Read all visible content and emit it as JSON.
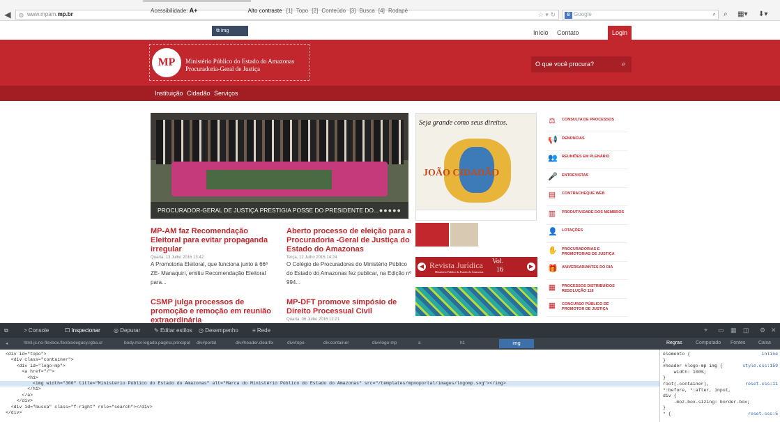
{
  "browser": {
    "url_prefix": "www.mpam.",
    "url_domain": "mp.br",
    "search_engine": "Google",
    "star_icon": "star-icon"
  },
  "topbar": {
    "accessibility_label": "Acessibilidade:",
    "font_increase": "A+",
    "contrast": "Alto contraste",
    "skip_links": "[1] Topo  [2] Conteúdo  [3] Busca  [4] Rodapé",
    "tooltip": "img",
    "inicio": "Início",
    "contato": "Contato",
    "login": "Login"
  },
  "header": {
    "logo_letters": "MP",
    "line1": "Ministério Público do Estado do Amazonas",
    "line2": "Procuradoria-Geral de Justiça",
    "search_placeholder": "O que você procura?"
  },
  "nav": {
    "items": [
      "Instituição",
      "Cidadão",
      "Serviços"
    ]
  },
  "hero": {
    "caption": "PROCURADOR-GERAL DE JUSTIÇA PRESTIGIA POSSE DO PRESIDENTE DO...",
    "dots": "●●●●●"
  },
  "news": [
    {
      "title": "MP-AM faz Recomendação Eleitoral para evitar propaganda irregular",
      "date": "Quarta, 13 Julho 2016 13:42",
      "text": "A Promotoria Eleitoral, que funciona junto à 66ª ZE- Manaquiri, emitiu Recomendação Eleitoral para..."
    },
    {
      "title": "Aberto processo de eleição para a Procuradoria -Geral de Justiça do Estado do Amazonas",
      "date": "Terça, 12 Julho 2016 14:24",
      "text": "O Colégio de Procuradores do Ministério Público do Estado do Amazonas fez publicar, na Edição nº 994..."
    },
    {
      "title": "CSMP julga processos de promoção e remoção em reunião extraordinária",
      "date": "",
      "text": ""
    },
    {
      "title": "MP-DFT promove simpósio de Direito Processual Civil",
      "date": "Quarta, 06 Julho 2016 12:21",
      "text": ""
    }
  ],
  "campaign": {
    "slogan": "Seja grande como seus direitos.",
    "word": "JOÃO CIDADÃO"
  },
  "revista": {
    "title": "Revista Jurídica",
    "vol": "Vol.",
    "vol_num": "16",
    "subtitle": "Ministério Público do Estado do Amazonas"
  },
  "side_items": [
    {
      "icon": "gavel-icon",
      "glyph": "⚖",
      "label": "Consulta de Processos"
    },
    {
      "icon": "megaphone-icon",
      "glyph": "📢",
      "label": "Denúncias"
    },
    {
      "icon": "people-icon",
      "glyph": "👥",
      "label": "Reuniões em Plenário"
    },
    {
      "icon": "microphone-icon",
      "glyph": "🎤",
      "label": "Entrevistas"
    },
    {
      "icon": "document-icon",
      "glyph": "▤",
      "label": "Contracheque Web"
    },
    {
      "icon": "chart-icon",
      "glyph": "▥",
      "label": "Produtividade dos Membros"
    },
    {
      "icon": "person-icon",
      "glyph": "👤",
      "label": "Lotações"
    },
    {
      "icon": "handshake-icon",
      "glyph": "✋",
      "label": "Procuradorias e Promotorias de Justiça"
    },
    {
      "icon": "gift-icon",
      "glyph": "🎁",
      "label": "Aniversariantes do Dia"
    },
    {
      "icon": "clipboard-icon",
      "glyph": "▦",
      "label": "Processos Distribuídos Resolução 118"
    },
    {
      "icon": "calendar-icon",
      "glyph": "▦",
      "label": "Concurso Público de Promotor de Justiça"
    }
  ],
  "devtools": {
    "tabs": [
      "Console",
      "Inspecionar",
      "Depurar",
      "Editar estilos",
      "Desempenho",
      "Rede"
    ],
    "active_tab": "Inspecionar",
    "breadcrumbs": [
      "html.js.no-flexbox.flexboxlegacy.rgba.sr",
      "body.mix-legado.pagina.principal",
      "div#portal",
      "div#header.clearfix",
      "div#topo",
      "div.container",
      "div#logo-mp",
      "a",
      "h1",
      "img"
    ],
    "side_tabs": [
      "Regras",
      "Computado",
      "Fontes",
      "Caixa"
    ],
    "html_lines": [
      "<div id=\"topo\">",
      "  <div class=\"container\">",
      "    <div id=\"logo-mp\">",
      "      <a href=\"/\">",
      "        <h1>",
      "          <img width=\"300\" title=\"Ministério Público do Estado do Amazonas\" alt=\"Marca do Ministério Público do Estado do Amazonas\" src=\"/templates/mpnoportal/images/logomp.svg\"></img>",
      "        </h1>",
      "      </a>",
      "    </div>",
      "  <div id=\"busca\" class=\"f-right\" role=\"search\"></div>",
      "</div>"
    ],
    "rules": [
      {
        "text": "elemento {",
        "src": "inline"
      },
      {
        "text": "}",
        "src": ""
      },
      {
        "text": "#header #logo-mp img {",
        "src": "style.css:159"
      },
      {
        "text": "    width: 100%;",
        "src": ""
      },
      {
        "text": "}",
        "src": ""
      },
      {
        "text": "root(.container),",
        "src": "reset.css:11"
      },
      {
        "text": "*:before, *:after, input,",
        "src": ""
      },
      {
        "text": "div {",
        "src": ""
      },
      {
        "text": "    -moz-box-sizing: border-box;",
        "src": ""
      },
      {
        "text": "}",
        "src": ""
      },
      {
        "text": "* {",
        "src": "reset.css:5"
      }
    ]
  }
}
